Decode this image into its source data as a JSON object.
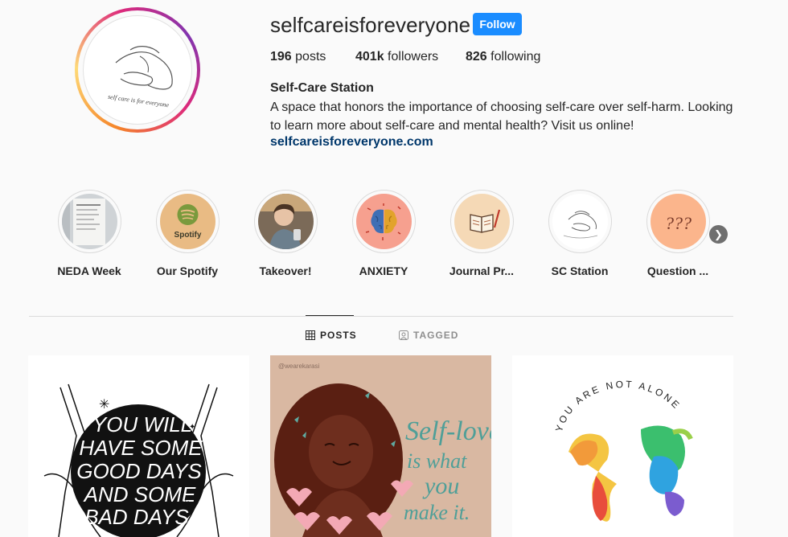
{
  "profile": {
    "username": "selfcareisforeveryone",
    "follow_label": "Follow",
    "posts_count": "196",
    "posts_label": " posts",
    "followers_count": "401k",
    "followers_label": " followers",
    "following_count": "826",
    "following_label": " following",
    "full_name": "Self-Care Station",
    "bio": "A space that honors the importance of choosing self-care over self-harm. Looking to learn more about self-care and mental health? Visit us online!",
    "website": "selfcareisforeveryone.com",
    "accent_color": "#1a8cff"
  },
  "highlights": [
    {
      "label": "NEDA Week",
      "icon": "poster-photo"
    },
    {
      "label": "Our Spotify",
      "icon": "spotify-icon",
      "inner_text": "Spotify"
    },
    {
      "label": "Takeover!",
      "icon": "person-photo"
    },
    {
      "label": "ANXIETY",
      "icon": "brain-icon"
    },
    {
      "label": "Journal Pr...",
      "icon": "journal-icon"
    },
    {
      "label": "SC Station",
      "icon": "hug-logo"
    },
    {
      "label": "Question ...",
      "icon": "question-marks",
      "inner_text": "???"
    }
  ],
  "tabs": {
    "posts": "POSTS",
    "tagged": "TAGGED"
  },
  "posts": [
    {
      "text": "YOU WILL HAVE SOME GOOD DAYS AND SOME BAD DAYS"
    },
    {
      "credit": "@wearekarasi",
      "text_line1": "Self-love",
      "text_line2": "is what",
      "text_line3": "you",
      "text_line4": "make it."
    },
    {
      "text": "YOU ARE NOT ALONE"
    }
  ]
}
